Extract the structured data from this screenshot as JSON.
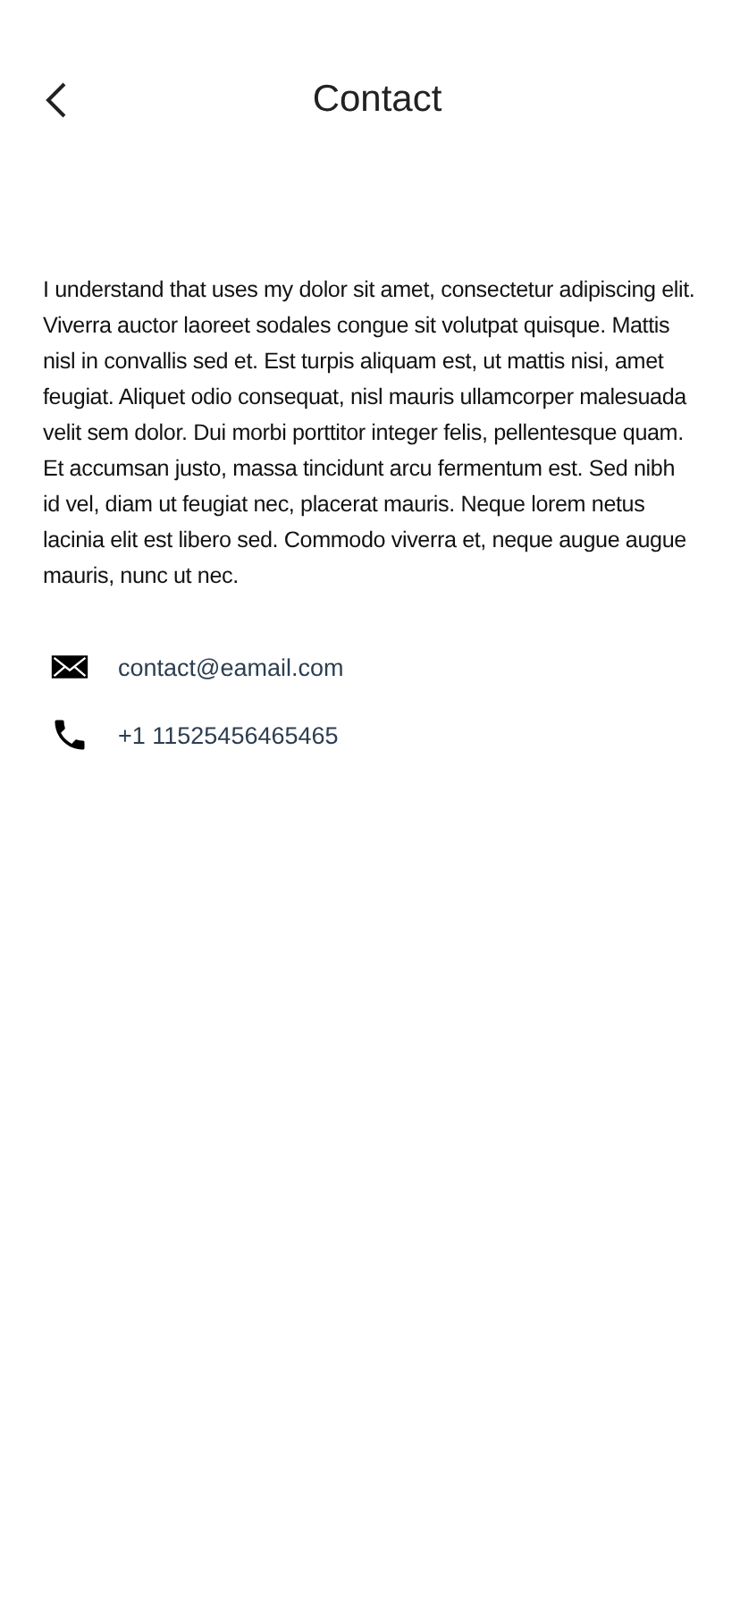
{
  "header": {
    "title": "Contact"
  },
  "body": "I understand that uses my  dolor sit amet, consectetur adipiscing elit. Viverra auctor laoreet sodales congue sit volutpat quisque. Mattis nisl in convallis sed et. Est turpis aliquam est, ut mattis nisi, amet feugiat. Aliquet odio consequat, nisl mauris ullamcorper malesuada velit sem dolor. Dui morbi porttitor integer felis, pellentesque quam. Et accumsan justo, massa tincidunt arcu fermentum est. Sed nibh id vel, diam ut feugiat nec, placerat mauris. Neque lorem netus lacinia elit est libero sed. Commodo viverra et, neque augue augue mauris, nunc ut nec.",
  "contacts": [
    {
      "kind": "email",
      "text": "contact@eamail.com"
    },
    {
      "kind": "phone",
      "text": "+1 11525456465465"
    }
  ]
}
